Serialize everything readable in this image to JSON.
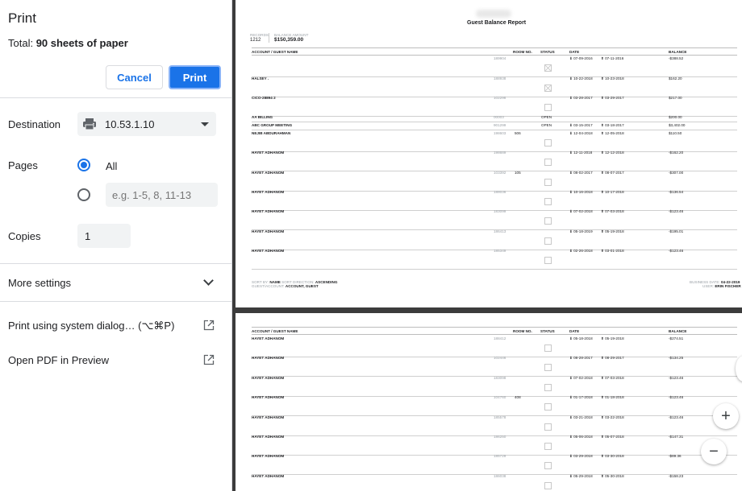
{
  "panel": {
    "title": "Print",
    "total_prefix": "Total: ",
    "total_value": "90 sheets of paper",
    "cancel_label": "Cancel",
    "print_label": "Print",
    "destination_label": "Destination",
    "destination_value": "10.53.1.10",
    "pages_label": "Pages",
    "pages_all_label": "All",
    "pages_custom_placeholder": "e.g. 1-5, 8, 11-13",
    "copies_label": "Copies",
    "copies_value": "1",
    "more_settings_label": "More settings",
    "system_dialog_label": "Print using system dialog… (⌥⌘P)",
    "open_pdf_label": "Open PDF in Preview"
  },
  "report": {
    "title": "Guest Balance Report",
    "records_label": "RECORDS",
    "records_value": "1212",
    "balance_amount_label": "BALANCE AMOUNT",
    "balance_amount_value": "$150,359.00",
    "columns": [
      "ACCOUNT / GUEST NAME",
      "ROOM NO.",
      "STATUS",
      "DATE",
      "BALANCE"
    ],
    "page1_rows": [
      {
        "name": "",
        "id": "189904",
        "room": "",
        "status": "",
        "in": "07-09-2016",
        "out": "07-11-2016",
        "balance": "-$388.52",
        "x": true
      },
      {
        "name": "HALSEY .",
        "id": "188938",
        "room": "",
        "status": "",
        "in": "10-22-2018",
        "out": "10-23-2018",
        "balance": "$162.20",
        "x": true
      },
      {
        "name": "CICO-28894 2",
        "id": "102298",
        "room": "",
        "status": "",
        "in": "03-28-2017",
        "out": "03-29-2017",
        "balance": "$217.00",
        "x": false
      },
      {
        "name": "AA BILLING",
        "id": "00003",
        "room": "",
        "status": "OPEN",
        "in": "",
        "out": "",
        "balance": "$200.00",
        "x": false,
        "nobox": true
      },
      {
        "name": "ABC GROUP MEETING",
        "id": "901299",
        "room": "",
        "status": "OPEN",
        "in": "03-15-2017",
        "out": "03-18-2017",
        "balance": "$3,402.00",
        "x": false,
        "nobox": true
      },
      {
        "name": "NEJIB ABDURAHMAN",
        "id": "198603",
        "room": "506",
        "status": "",
        "in": "12-04-2018",
        "out": "12-05-2018",
        "balance": "$110.50",
        "x": false
      },
      {
        "name": "HAYET ADHANOM",
        "id": "198689",
        "room": "",
        "status": "",
        "in": "12-11-2018",
        "out": "12-12-2018",
        "balance": "-$162.20",
        "x": false
      },
      {
        "name": "HAYET ADHANOM",
        "id": "103392",
        "room": "105",
        "status": "",
        "in": "08-02-2017",
        "out": "08-07-2017",
        "balance": "-$307.00",
        "x": false
      },
      {
        "name": "HAYET ADHANOM",
        "id": "188036",
        "room": "",
        "status": "",
        "in": "10-16-2018",
        "out": "10-17-2018",
        "balance": "-$136.54",
        "x": false
      },
      {
        "name": "HAYET ADHANOM",
        "id": "183099",
        "room": "",
        "status": "",
        "in": "07-02-2018",
        "out": "07-03-2018",
        "balance": "-$123.46",
        "x": false
      },
      {
        "name": "HAYET ADHANOM",
        "id": "186413",
        "room": "",
        "status": "",
        "in": "05-18-2019",
        "out": "05-19-2018",
        "balance": "-$195.01",
        "x": false
      },
      {
        "name": "HAYET ADHANOM",
        "id": "185349",
        "room": "",
        "status": "",
        "in": "02-26-2018",
        "out": "03-01-2018",
        "balance": "-$123.46",
        "x": false
      }
    ],
    "footer": {
      "sort_by_label": "SORT BY:",
      "sort_by_value": "NAME",
      "sort_dir_label": "SORT DIRECTION:",
      "sort_dir_value": "ASCENDING",
      "guest_label": "GUEST/ACCOUNT:",
      "guest_value": "ACCOUNT, GUEST",
      "business_date_label": "BUSINESS DATE:",
      "business_date_value": "04-22-2019",
      "user_label": "USER:",
      "user_value": "ERIN FISCHER"
    },
    "page2_rows": [
      {
        "name": "HAYET ADHANOM",
        "id": "188412",
        "room": "",
        "in": "05-18-2018",
        "out": "05-19-2018",
        "balance": "-$274.51"
      },
      {
        "name": "HAYET ADHANOM",
        "id": "102446",
        "room": "",
        "in": "08-28-2017",
        "out": "08-29-2017",
        "balance": "-$134.25"
      },
      {
        "name": "HAYET ADHANOM",
        "id": "183098",
        "room": "",
        "in": "07-02-2018",
        "out": "07-03-2018",
        "balance": "-$123.46"
      },
      {
        "name": "HAYET ADHANOM",
        "id": "104760",
        "room": "408",
        "in": "01-17-2018",
        "out": "01-18-2018",
        "balance": "-$123.46"
      },
      {
        "name": "HAYET ADHANOM",
        "id": "185578",
        "room": "",
        "in": "03-21-2018",
        "out": "03-22-2018",
        "balance": "-$123.46"
      },
      {
        "name": "HAYET ADHANOM",
        "id": "186250",
        "room": "",
        "in": "05-06-2018",
        "out": "05-07-2018",
        "balance": "-$147.31"
      },
      {
        "name": "HAYET ADHANOM",
        "id": "185729",
        "room": "",
        "in": "03-29-2018",
        "out": "03-30-2018",
        "balance": "-$89.36"
      },
      {
        "name": "HAYET ADHANOM",
        "id": "186038",
        "room": "",
        "in": "05-29-2018",
        "out": "05-30-2018",
        "balance": "-$158.23"
      }
    ]
  },
  "zoom": {
    "in_glyph": "+",
    "out_glyph": "−"
  },
  "colors": {
    "accent": "#1a73e8",
    "panel_bg": "#ffffff",
    "preview_bg": "#3c3c3c"
  }
}
